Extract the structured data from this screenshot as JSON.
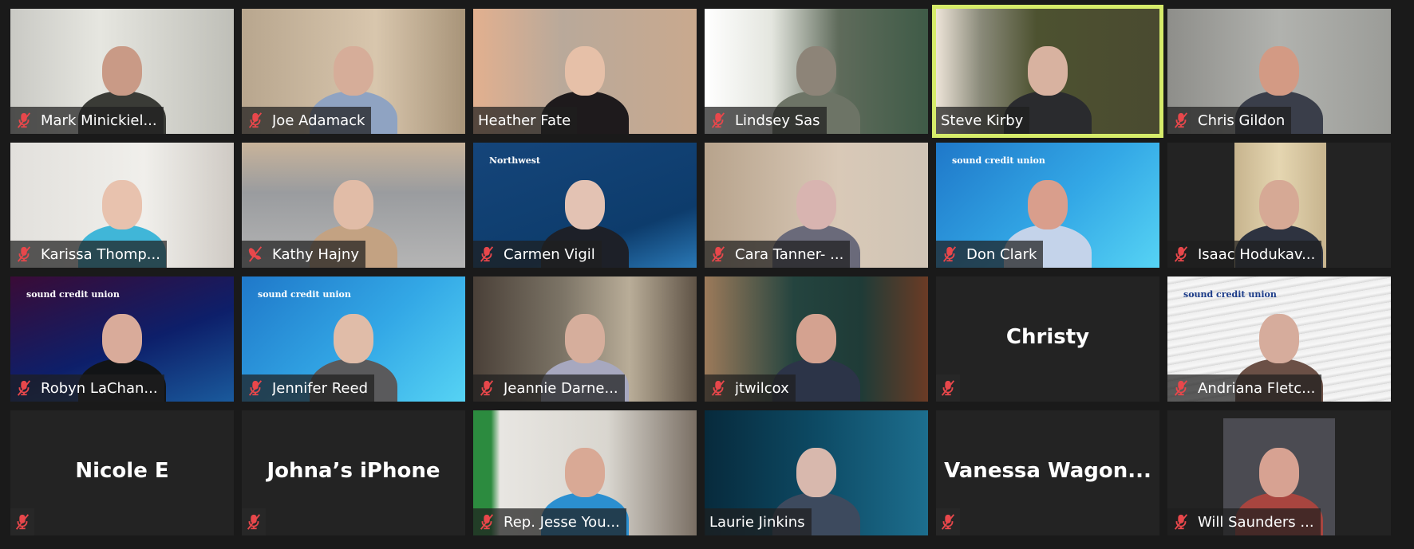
{
  "app": "Zoom Meeting - Gallery View",
  "colors": {
    "background": "#1a1a1a",
    "tile_empty": "#232323",
    "active_speaker_border": "#d6ec6a",
    "muted_icon": "#e8474b"
  },
  "participants": [
    {
      "name": "Mark Minickiel...",
      "muted": true,
      "video": true,
      "active": false,
      "bg": "linear-gradient(90deg,#c9c9c4 0%,#e6e6e0 40%,#bfbfb8 100%)",
      "skin": "#c99a86",
      "shirt": "#3a3b36"
    },
    {
      "name": "Joe Adamack",
      "muted": true,
      "video": true,
      "active": false,
      "bg": "linear-gradient(90deg,#b8a68e 0%,#d8c6ad 60%,#a89479 100%)",
      "skin": "#d6ad99",
      "shirt": "#8fa3c2"
    },
    {
      "name": "Heather Fate",
      "muted": false,
      "video": true,
      "active": false,
      "bg": "linear-gradient(90deg,#e2b08f 0%,#b9a99a 40%,#c9a98e 100%)",
      "skin": "#e6c0a8",
      "shirt": "#1e1a1c"
    },
    {
      "name": "Lindsey Sas",
      "muted": true,
      "video": true,
      "active": false,
      "bg": "linear-gradient(90deg,#ffffff 0%,#e4e6df 30%,#5f6b5b 60%,#3f5b47 100%)",
      "skin": "#8d8478",
      "shirt": "#6d7466"
    },
    {
      "name": "Steve Kirby",
      "muted": false,
      "video": true,
      "active": true,
      "bg": "linear-gradient(90deg,#ede4d8 0%,#8a8a7a 20%,#4d5230 45%,#4a4a30 100%)",
      "skin": "#d8b2a0",
      "shirt": "#2a2b2e"
    },
    {
      "name": "Chris Gildon",
      "muted": true,
      "video": true,
      "active": false,
      "bg": "linear-gradient(90deg,#8e8e8a 0%,#b1b2ae 50%,#9b9c98 100%)",
      "skin": "#d39a84",
      "shirt": "#3a3e4a"
    },
    {
      "name": "Karissa Thomp...",
      "muted": true,
      "video": true,
      "active": false,
      "bg": "linear-gradient(90deg,#e2e0dc 0%,#f0efeb 60%,#cfcac4 100%)",
      "skin": "#e8c2ae",
      "shirt": "#40b6d8"
    },
    {
      "name": "Kathy Hajny",
      "muted": true,
      "video": true,
      "active": false,
      "bg": "linear-gradient(180deg,#c8b39a 0%,#9a9c9f 40%,#b5b5b5 100%)",
      "skin": "#e1bca7",
      "shirt": "#c3a282",
      "mic_style": "unmuting"
    },
    {
      "name": "Carmen Vigil",
      "muted": true,
      "video": true,
      "active": false,
      "bg": "linear-gradient(160deg,#15457a 0%,#0d3c6c 70%,#2a78b5 100%)",
      "skin": "#e3c2b3",
      "shirt": "#1d2028",
      "logo": "Northwest"
    },
    {
      "name": "Cara Tanner- ...",
      "muted": true,
      "video": true,
      "active": false,
      "bg": "linear-gradient(90deg,#b7a38c 0%,#d9c9b7 60%,#cfc4b6 100%)",
      "skin": "#d8b4b0",
      "shirt": "#6a6a7a"
    },
    {
      "name": "Don Clark",
      "muted": true,
      "video": true,
      "active": false,
      "bg": "linear-gradient(135deg,#1f78c9 0%,#33a8e6 55%,#56d3f4 100%)",
      "skin": "#d99e8c",
      "shirt": "#c4d3ea",
      "logo": "sound credit union"
    },
    {
      "name": "Isaac Hodukav...",
      "muted": true,
      "video": true,
      "active": false,
      "bg": "linear-gradient(90deg,#232323 0%,#232323 30%,#c7b48e 30%,#e5d6b1 50%,#c7b48e 71%,#232323 71%)",
      "skin": "#d6a995",
      "shirt": "#2e3340"
    },
    {
      "name": "Robyn LaChan...",
      "muted": true,
      "video": true,
      "active": false,
      "bg": "linear-gradient(160deg,#3a0b36 0%,#0d1f6a 55%,#1a5a9c 100%)",
      "skin": "#d9ab9a",
      "shirt": "#121416",
      "logo": "sound credit union"
    },
    {
      "name": "Jennifer Reed",
      "muted": true,
      "video": true,
      "active": false,
      "bg": "linear-gradient(135deg,#1f78c9 0%,#33a8e6 55%,#56d3f4 100%)",
      "skin": "#e0bca8",
      "shirt": "#5a5a5c",
      "logo": "sound credit union"
    },
    {
      "name": "Jeannie Darne...",
      "muted": true,
      "video": true,
      "active": false,
      "bg": "linear-gradient(90deg,#4a4038 0%,#7c7466 40%,#b9ad98 70%,#5f5346 100%)",
      "skin": "#d6ae9c",
      "shirt": "#a7a8bf"
    },
    {
      "name": "jtwilcox",
      "muted": true,
      "video": true,
      "active": false,
      "bg": "linear-gradient(90deg,#9c7a5a 0%,#24443f 40%,#1f3b37 70%,#6b3b25 100%)",
      "skin": "#d4a290",
      "shirt": "#2c3448"
    },
    {
      "name": "Christy",
      "muted": true,
      "video": false,
      "active": false
    },
    {
      "name": "Andriana Fletc...",
      "muted": true,
      "video": true,
      "active": false,
      "bg": "repeating-linear-gradient(170deg,#eeeeee 0px,#f7f7f7 6px,#d8d8d8 10px)",
      "skin": "#d6ac9c",
      "shirt": "#6b5046",
      "logo": "sound credit union"
    },
    {
      "name": "Nicole E",
      "muted": true,
      "video": false,
      "active": false
    },
    {
      "name": "Johna’s iPhone",
      "muted": true,
      "video": false,
      "active": false
    },
    {
      "name": "Rep. Jesse You...",
      "muted": true,
      "video": true,
      "active": false,
      "bg": "linear-gradient(90deg,#2c8b3f 0%,#2c8b3f 8%,#e8e6e2 12%,#d9d6cf 60%,#7a6f64 100%)",
      "skin": "#d9a995",
      "shirt": "#2b8fd0"
    },
    {
      "name": "Laurie Jinkins",
      "muted": false,
      "video": true,
      "active": false,
      "bg": "linear-gradient(90deg,#072a3c 0%,#0d4a64 50%,#1d6e8e 100%)",
      "skin": "#d8b8ad",
      "shirt": "#3d4a5e"
    },
    {
      "name": "Vanessa  Wagon...",
      "muted": true,
      "video": false,
      "active": false
    },
    {
      "name": "Will Saunders ...",
      "muted": true,
      "video": false,
      "active": false,
      "avatar": true,
      "bg": "#4b4b52",
      "skin": "#d7a292",
      "shirt": "#a8453f"
    }
  ]
}
